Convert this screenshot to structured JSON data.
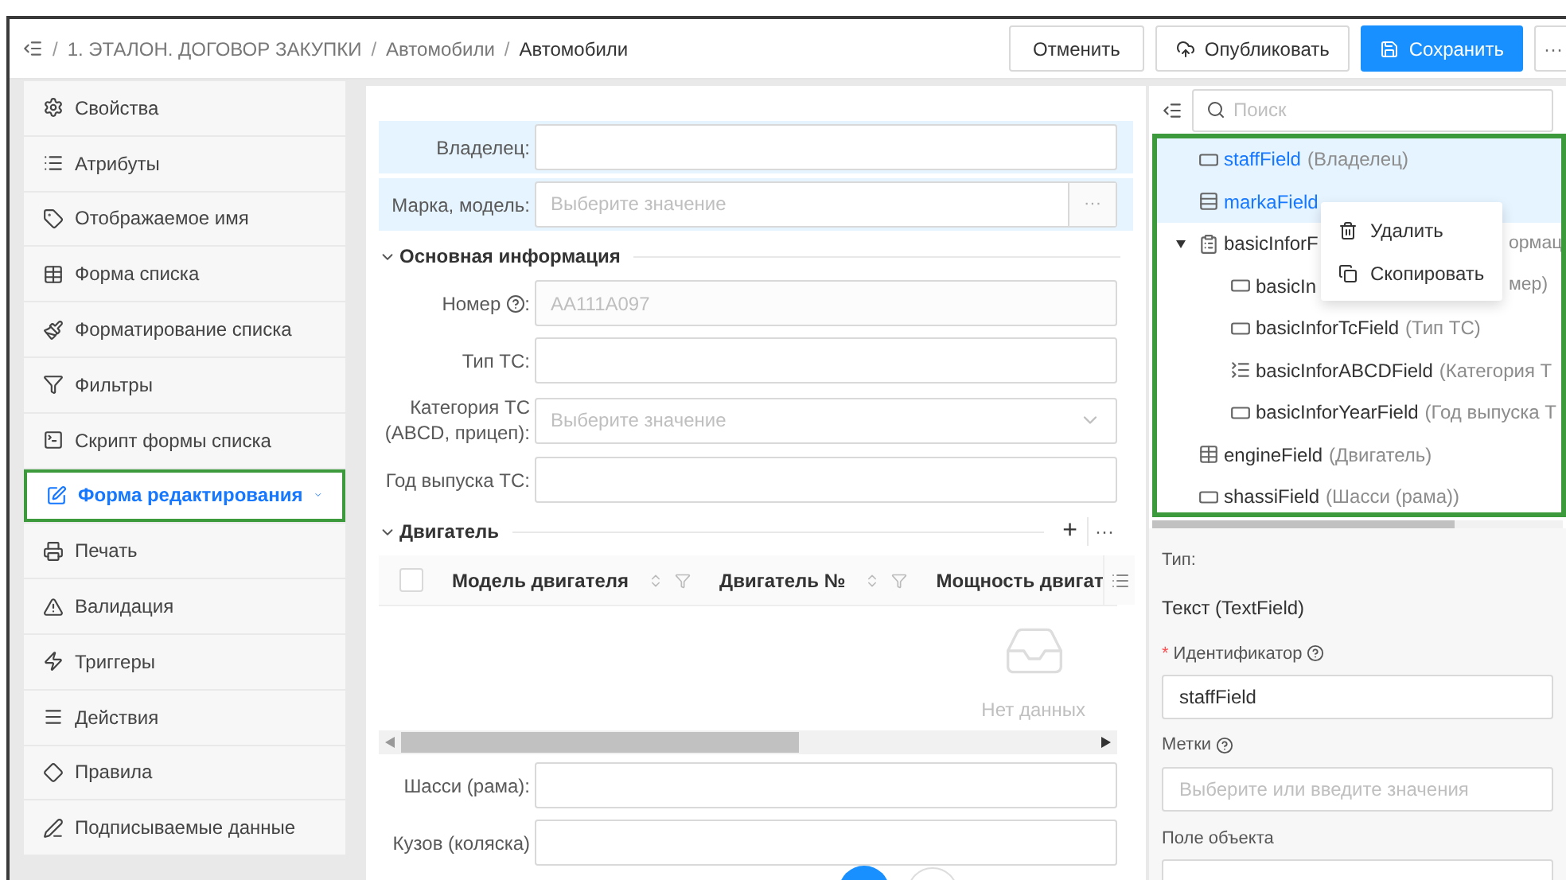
{
  "breadcrumbs": [
    {
      "separator": "/",
      "label": "1. ЭТАЛОН. ДОГОВОР ЗАКУПКИ"
    },
    {
      "separator": "/",
      "label": "Автомобили"
    },
    {
      "separator": "/",
      "label": "Автомобили"
    }
  ],
  "header_buttons": [
    {
      "kind": "plain",
      "label": "Отменить"
    },
    {
      "kind": "publish",
      "label": "Опубликовать"
    },
    {
      "kind": "primary",
      "label": "Сохранить"
    },
    {
      "kind": "more",
      "label": "···"
    }
  ],
  "sidebar": {
    "items": [
      {
        "label": "Свойства",
        "selected": false
      },
      {
        "label": "Атрибуты",
        "selected": false
      },
      {
        "label": "Отображаемое имя",
        "selected": false
      },
      {
        "label": "Форма списка",
        "selected": false
      },
      {
        "label": "Форматирование списка",
        "selected": false
      },
      {
        "label": "Фильтры",
        "selected": false
      },
      {
        "label": "Скрипт формы списка",
        "selected": false
      },
      {
        "label": "Форма редактирования",
        "selected": true
      },
      {
        "label": "Печать",
        "selected": false
      },
      {
        "label": "Валидация",
        "selected": false
      },
      {
        "label": "Триггеры",
        "selected": false
      },
      {
        "label": "Действия",
        "selected": false
      },
      {
        "label": "Правила",
        "selected": false
      },
      {
        "label": "Подписываемые данные",
        "selected": false
      }
    ]
  },
  "form": {
    "top_fields": [
      {
        "label": "Владелец:",
        "kind": "text",
        "highlighted": true
      },
      {
        "label": "Марка, модель:",
        "kind": "lookup",
        "placeholder": "Выберите значение",
        "button_label": "···",
        "highlighted": true
      }
    ],
    "sections": [
      {
        "title": "Основная информация",
        "expanded": true,
        "fields": [
          {
            "label": "Номер",
            "help": true,
            "suffix": ":",
            "kind": "text",
            "value": "AA111A097",
            "disabled": true
          },
          {
            "label": "Тип ТС:",
            "kind": "text"
          },
          {
            "label": "Категория ТС (ABCD, прицеп):",
            "kind": "select",
            "placeholder": "Выберите значение"
          },
          {
            "label": "Год выпуска ТС:",
            "kind": "text"
          }
        ]
      },
      {
        "title": "Двигатель",
        "expanded": true,
        "add_label": "+",
        "more_label": "···",
        "table": {
          "columns": [
            "Модель двигателя",
            "Двигатель №",
            "Мощность двигат"
          ],
          "all_checked": false,
          "empty_text": "Нет данных"
        }
      }
    ],
    "bottom_fields": [
      {
        "label": "Шасси (рама):",
        "kind": "text"
      },
      {
        "label": "Кузов (коляска)",
        "kind": "text"
      }
    ]
  },
  "tree": {
    "search_placeholder": "Поиск",
    "items": [
      {
        "kind": "input",
        "name": "staffField",
        "caption": "(Владелец)",
        "selected": true
      },
      {
        "kind": "lookup",
        "name": "markaField",
        "selected": true
      },
      {
        "kind": "group",
        "name": "basicInforF",
        "caption_after_menu": "ормац",
        "selected": false,
        "expanded": true,
        "children": [
          {
            "kind": "input",
            "name": "basicIn",
            "caption_after_menu": "мер)",
            "selected": false
          },
          {
            "kind": "input",
            "name": "basicInforTcField",
            "caption": "(Тип ТС)",
            "selected": false
          },
          {
            "kind": "select",
            "name": "basicInforABCDField",
            "caption": "(Категория Т",
            "selected": false
          },
          {
            "kind": "input",
            "name": "basicInforYearField",
            "caption": "(Год выпуска Т",
            "selected": false
          }
        ]
      },
      {
        "kind": "table",
        "name": "engineField",
        "caption": "(Двигатель)",
        "selected": false
      },
      {
        "kind": "input",
        "name": "shassiField",
        "caption": "(Шасси (рама))",
        "selected": false
      }
    ]
  },
  "context_menu": [
    {
      "kind": "delete",
      "label": "Удалить"
    },
    {
      "kind": "copy",
      "label": "Скопировать"
    }
  ],
  "properties": {
    "type_label": "Тип:",
    "type_value": "Текст (TextField)",
    "id_label": "Идентификатор",
    "id_required": "*",
    "id_value": "staffField",
    "tags_label": "Метки",
    "tags_placeholder": "Выберите или введите значения",
    "object_field_label": "Поле объекта"
  }
}
